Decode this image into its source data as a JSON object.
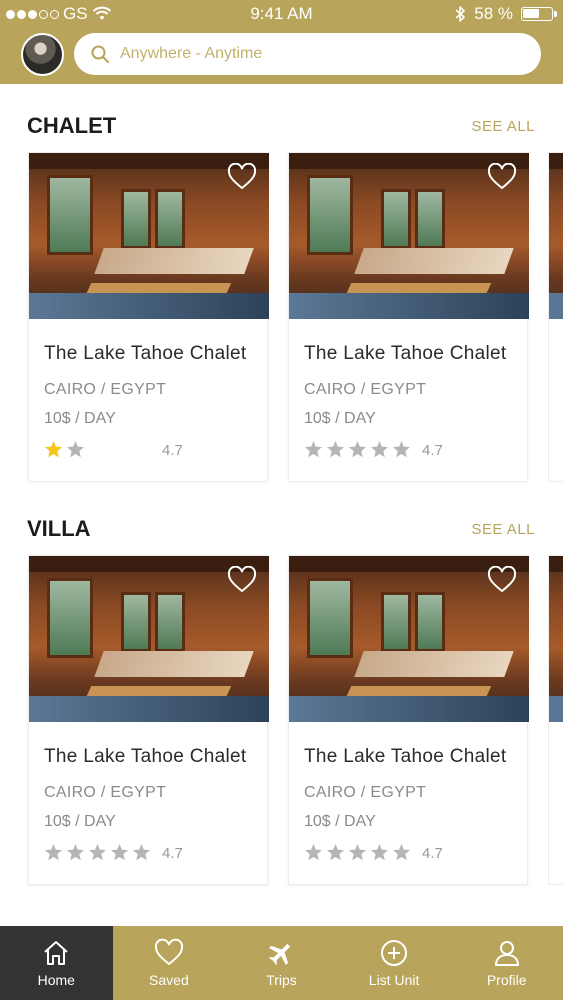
{
  "status_bar": {
    "carrier": "GS",
    "time": "9:41 AM",
    "battery": "58 %",
    "battery_level": 0.58
  },
  "search": {
    "placeholder": "Anywhere - Anytime"
  },
  "sections": [
    {
      "title": "CHALET",
      "see_all": "SEE ALL",
      "cards": [
        {
          "title": "The Lake Tahoe Chalet",
          "location": "CAIRO / EGYPT",
          "price": "10$ / DAY",
          "rating": "4.7",
          "stars_shown": 2,
          "stars_filled": 1
        },
        {
          "title": "The Lake Tahoe Chalet",
          "location": "CAIRO / EGYPT",
          "price": "10$ / DAY",
          "rating": "4.7",
          "stars_shown": 5,
          "stars_filled": 0
        }
      ]
    },
    {
      "title": "VILLA",
      "see_all": "SEE ALL",
      "cards": [
        {
          "title": "The Lake Tahoe Chalet",
          "location": "CAIRO / EGYPT",
          "price": "10$ / DAY",
          "rating": "4.7",
          "stars_shown": 5,
          "stars_filled": 0
        },
        {
          "title": "The Lake Tahoe Chalet",
          "location": "CAIRO / EGYPT",
          "price": "10$ / DAY",
          "rating": "4.7",
          "stars_shown": 5,
          "stars_filled": 0
        }
      ]
    }
  ],
  "tabs": [
    {
      "label": "Home",
      "icon": "home-icon"
    },
    {
      "label": "Saved",
      "icon": "heart-icon"
    },
    {
      "label": "Trips",
      "icon": "plane-icon"
    },
    {
      "label": "List Unit",
      "icon": "plus-circle-icon"
    },
    {
      "label": "Profile",
      "icon": "user-icon"
    }
  ],
  "colors": {
    "accent": "#b8a45a",
    "active_tab": "#333333",
    "star_filled": "#f5c518",
    "star_empty": "#b5b5b5"
  }
}
